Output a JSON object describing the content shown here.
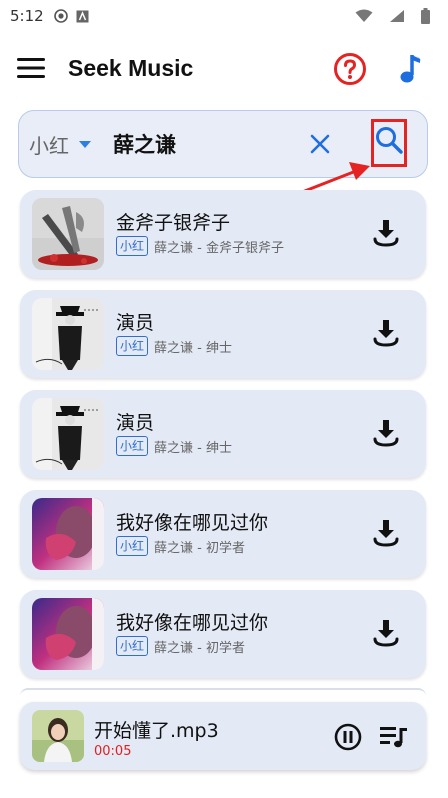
{
  "status_bar": {
    "time": "5:12"
  },
  "app_bar": {
    "title": "Seek Music"
  },
  "search": {
    "source": "小红",
    "query": "薛之谦"
  },
  "songs": [
    {
      "title": "金斧子银斧子",
      "source": "小红",
      "subtitle": "薛之谦 - 金斧子银斧子"
    },
    {
      "title": "演员",
      "source": "小红",
      "subtitle": "薛之谦 - 绅士"
    },
    {
      "title": "演员",
      "source": "小红",
      "subtitle": "薛之谦 - 绅士"
    },
    {
      "title": "我好像在哪见过你",
      "source": "小红",
      "subtitle": "薛之谦 - 初学者"
    },
    {
      "title": "我好像在哪见过你",
      "source": "小红",
      "subtitle": "薛之谦 - 初学者"
    }
  ],
  "player": {
    "track": "开始懂了.mp3",
    "elapsed": "00:05"
  },
  "colors": {
    "accent": "#2f7fe0",
    "card_bg": "#e3e9f5",
    "highlight": "#e52323"
  },
  "icons": [
    "menu-icon",
    "help-icon",
    "music-note-icon",
    "dropdown-icon",
    "clear-icon",
    "search-icon",
    "download-icon",
    "pause-icon",
    "queue-icon"
  ]
}
